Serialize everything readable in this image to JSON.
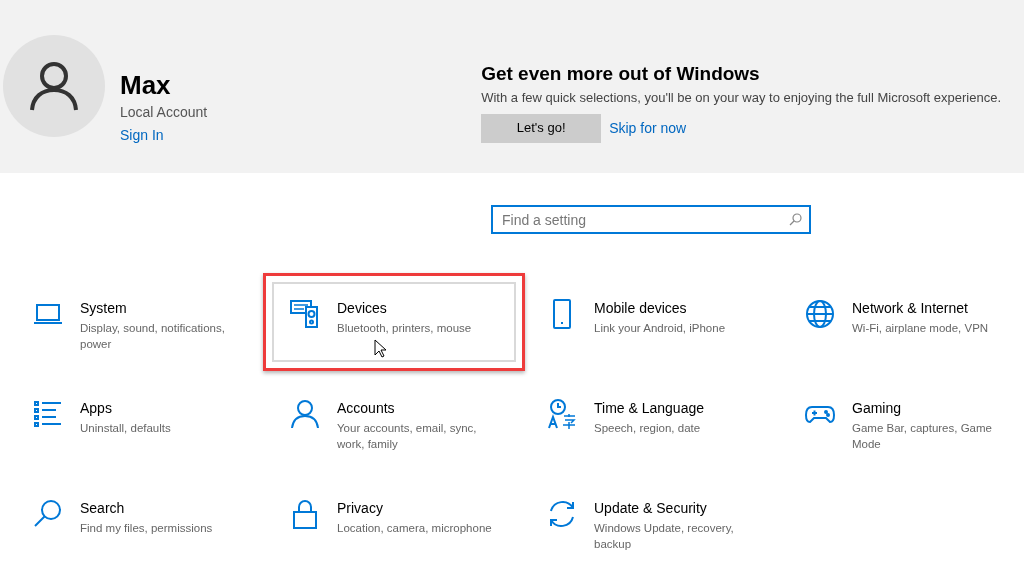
{
  "account": {
    "name": "Max",
    "type": "Local Account",
    "link": "Sign In"
  },
  "promo": {
    "title": "Get even more out of Windows",
    "text": "With a few quick selections, you'll be on your way to enjoying the full Microsoft experience.",
    "primary_button": "Let's go!",
    "secondary_link": "Skip for now"
  },
  "search": {
    "placeholder": "Find a setting"
  },
  "categories": [
    {
      "title": "System",
      "subtitle": "Display, sound, notifications, power",
      "highlighted": false
    },
    {
      "title": "Devices",
      "subtitle": "Bluetooth, printers, mouse",
      "highlighted": true
    },
    {
      "title": "Mobile devices",
      "subtitle": "Link your Android, iPhone",
      "highlighted": false
    },
    {
      "title": "Network & Internet",
      "subtitle": "Wi-Fi, airplane mode, VPN",
      "highlighted": false
    },
    {
      "title": "Apps",
      "subtitle": "Uninstall, defaults",
      "highlighted": false
    },
    {
      "title": "Accounts",
      "subtitle": "Your accounts, email, sync, work, family",
      "highlighted": false
    },
    {
      "title": "Time & Language",
      "subtitle": "Speech, region, date",
      "highlighted": false
    },
    {
      "title": "Gaming",
      "subtitle": "Game Bar, captures, Game Mode",
      "highlighted": false
    },
    {
      "title": "Search",
      "subtitle": "Find my files, permissions",
      "highlighted": false
    },
    {
      "title": "Privacy",
      "subtitle": "Location, camera, microphone",
      "highlighted": false
    },
    {
      "title": "Update & Security",
      "subtitle": "Windows Update, recovery, backup",
      "highlighted": false
    }
  ]
}
